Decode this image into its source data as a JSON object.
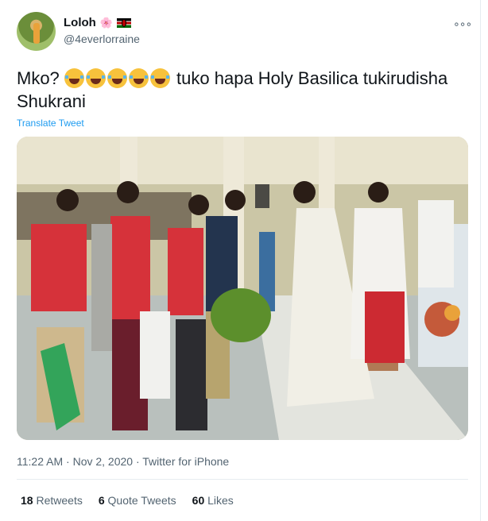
{
  "user": {
    "name": "Loloh",
    "handle": "@4everlorraine",
    "name_emojis": [
      "flower-emoji",
      "kenya-flag-emoji"
    ]
  },
  "tweet": {
    "text_prefix": "Mko?",
    "laugh_emoji_count": 5,
    "text_suffix": "tuko hapa Holy Basilica tukirudisha Shukrani",
    "translate_label": "Translate Tweet"
  },
  "meta": {
    "time": "11:22 AM",
    "separator": "·",
    "date": "Nov 2, 2020",
    "source": "Twitter for iPhone"
  },
  "stats": {
    "retweets_count": "18",
    "retweets_label": "Retweets",
    "quote_count": "6",
    "quote_label": "Quote Tweets",
    "likes_count": "60",
    "likes_label": "Likes"
  },
  "colors": {
    "link": "#1d9bf0",
    "secondary_text": "#536471",
    "primary_text": "#0f1419"
  }
}
